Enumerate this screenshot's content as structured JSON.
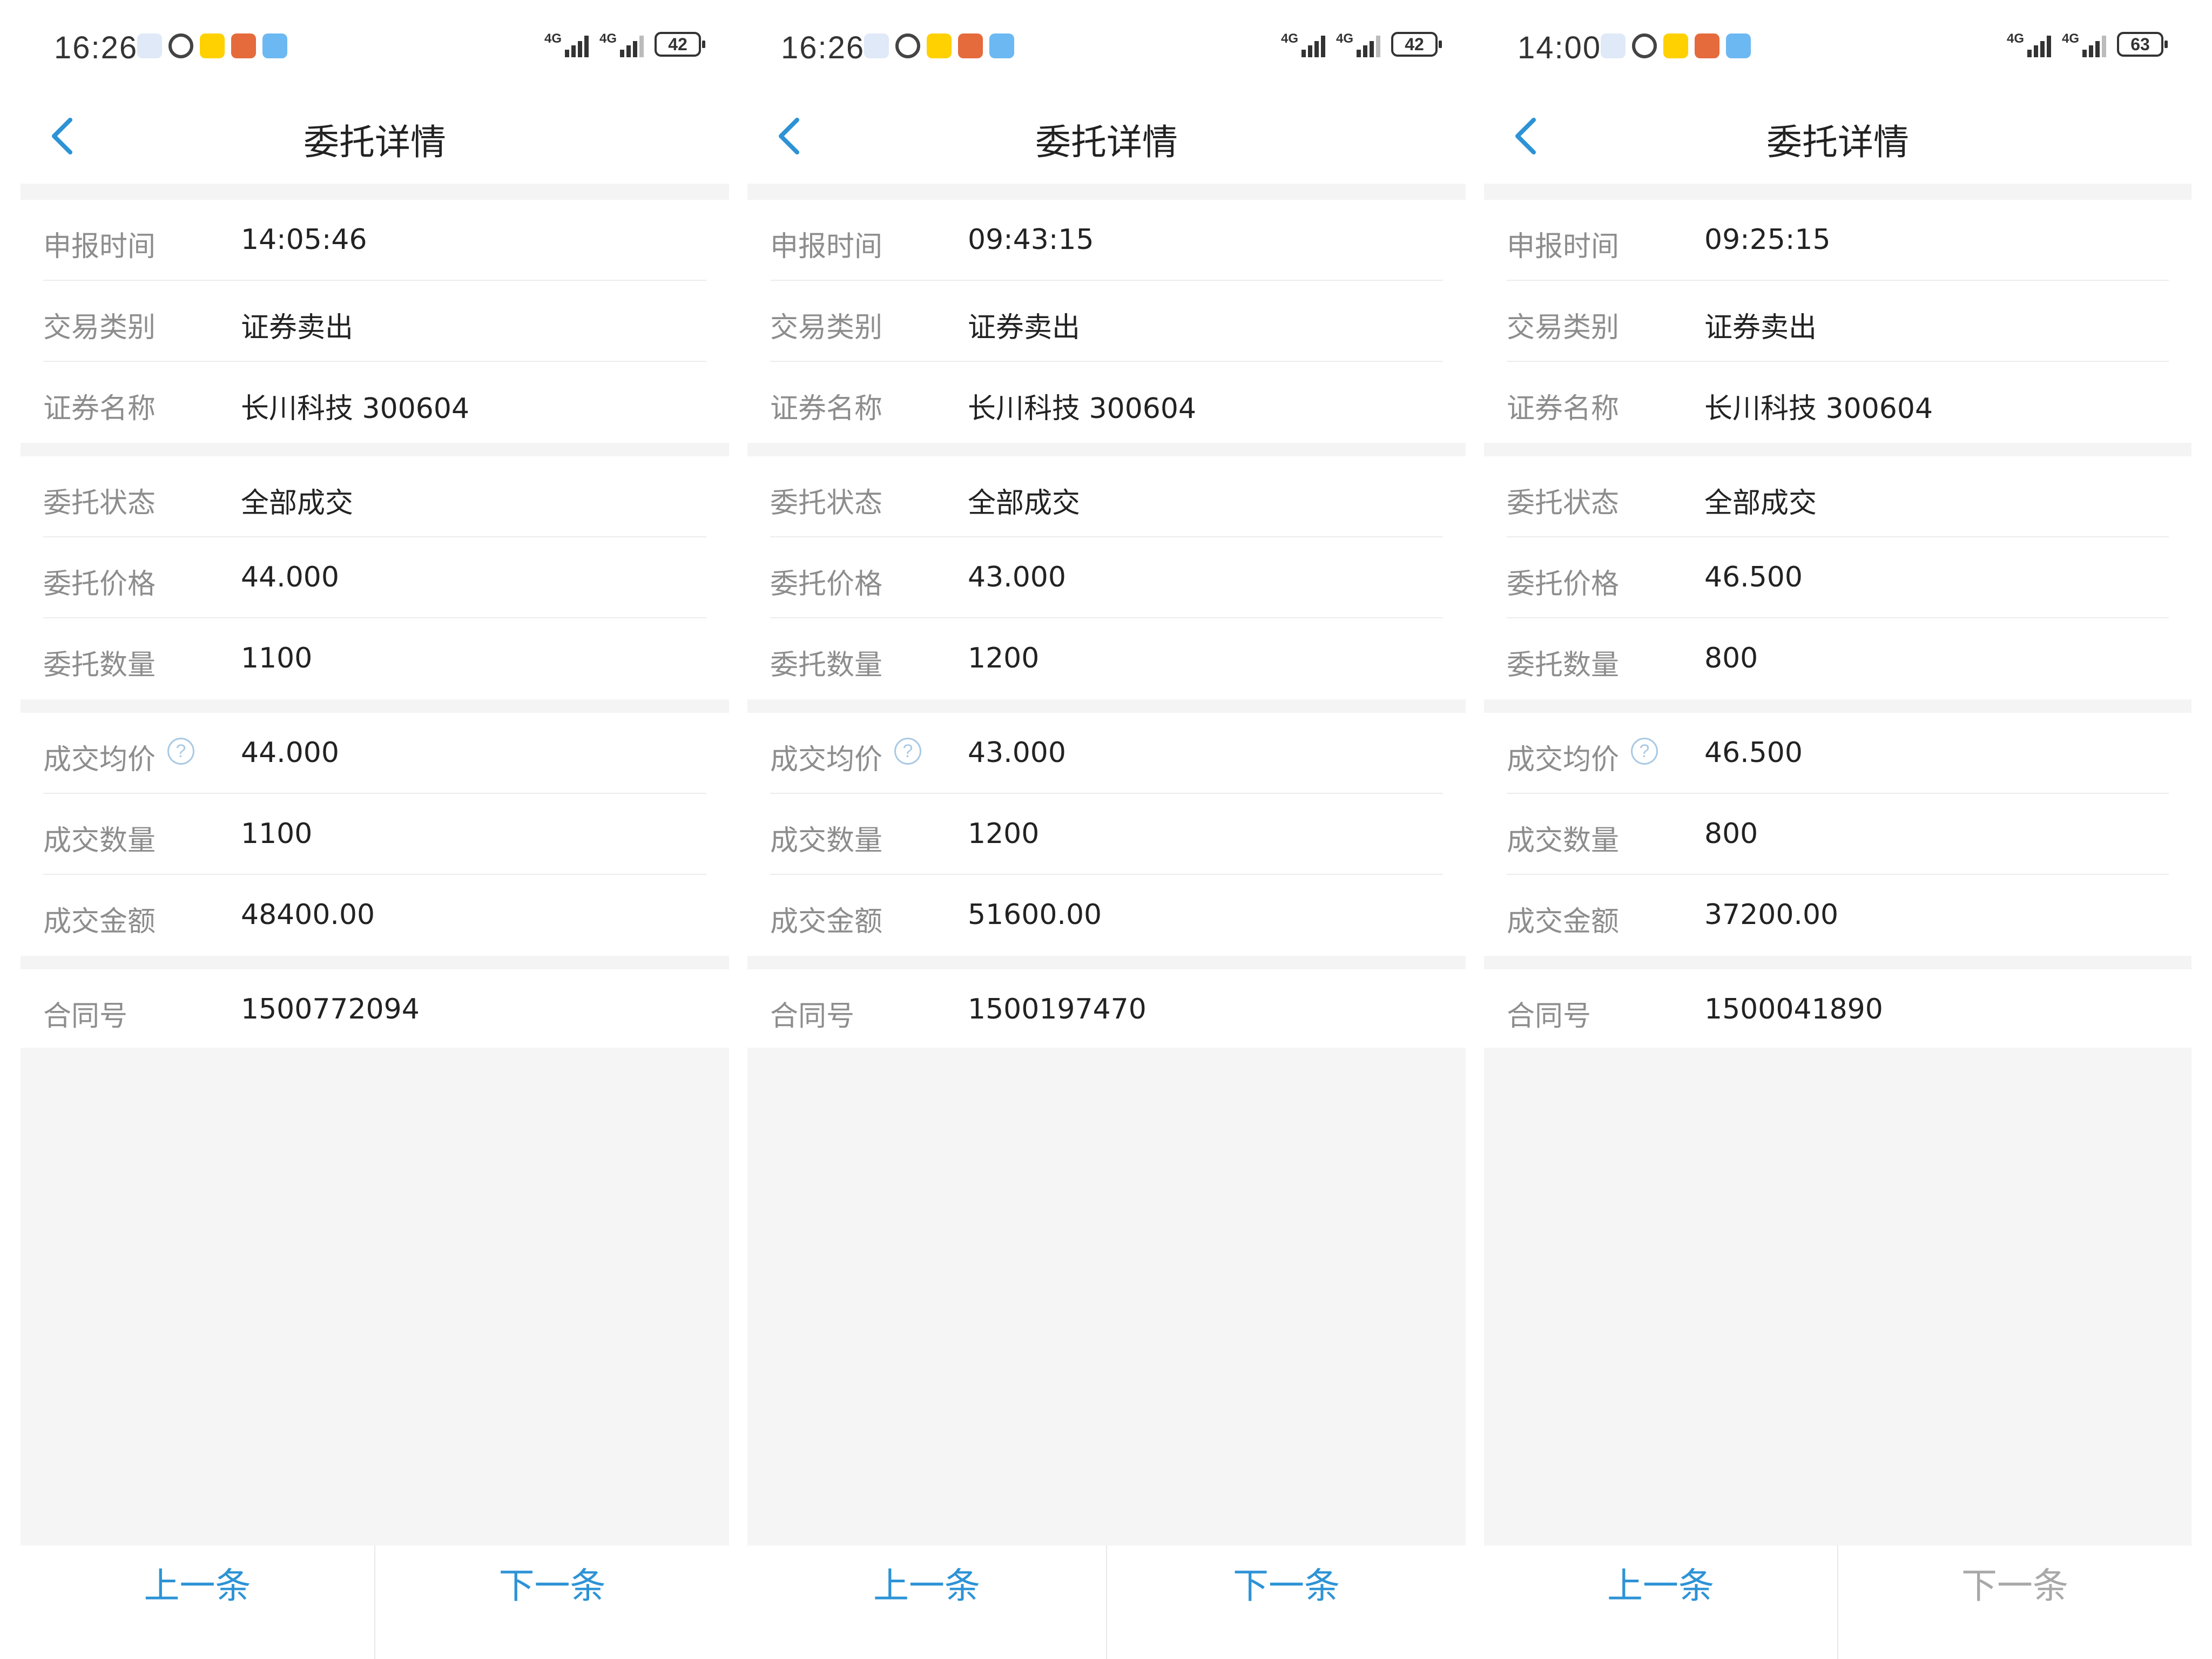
{
  "accent_color": "#2d93d6",
  "label_color": "#8d8d8d",
  "screens": [
    {
      "status_bar": {
        "time": "16:26",
        "network": "4G",
        "battery": "42",
        "notification_icons": [
          "cloud-app-icon",
          "record-icon",
          "meituan-icon",
          "game-icon",
          "weather-icon"
        ]
      },
      "title": "委托详情",
      "fields": {
        "declare_time": {
          "label": "申报时间",
          "value": "14:05:46"
        },
        "trade_type": {
          "label": "交易类别",
          "value": "证券卖出"
        },
        "security_name": {
          "label": "证券名称",
          "value": "长川科技 300604"
        },
        "order_status": {
          "label": "委托状态",
          "value": "全部成交"
        },
        "order_price": {
          "label": "委托价格",
          "value": "44.000"
        },
        "order_qty": {
          "label": "委托数量",
          "value": "1100"
        },
        "avg_price": {
          "label": "成交均价",
          "value": "44.000"
        },
        "filled_qty": {
          "label": "成交数量",
          "value": "1100"
        },
        "filled_amount": {
          "label": "成交金额",
          "value": "48400.00"
        },
        "contract_no": {
          "label": "合同号",
          "value": "1500772094"
        }
      },
      "help_glyph": "?",
      "prev_label": "上一条",
      "next_label": "下一条"
    },
    {
      "status_bar": {
        "time": "16:26",
        "network": "4G",
        "battery": "42",
        "notification_icons": [
          "cloud-app-icon",
          "record-icon",
          "meituan-icon",
          "game-icon",
          "weather-icon"
        ]
      },
      "title": "委托详情",
      "fields": {
        "declare_time": {
          "label": "申报时间",
          "value": "09:43:15"
        },
        "trade_type": {
          "label": "交易类别",
          "value": "证券卖出"
        },
        "security_name": {
          "label": "证券名称",
          "value": "长川科技 300604"
        },
        "order_status": {
          "label": "委托状态",
          "value": "全部成交"
        },
        "order_price": {
          "label": "委托价格",
          "value": "43.000"
        },
        "order_qty": {
          "label": "委托数量",
          "value": "1200"
        },
        "avg_price": {
          "label": "成交均价",
          "value": "43.000"
        },
        "filled_qty": {
          "label": "成交数量",
          "value": "1200"
        },
        "filled_amount": {
          "label": "成交金额",
          "value": "51600.00"
        },
        "contract_no": {
          "label": "合同号",
          "value": "1500197470"
        }
      },
      "help_glyph": "?",
      "prev_label": "上一条",
      "next_label": "下一条"
    },
    {
      "status_bar": {
        "time": "14:00",
        "network": "4G",
        "battery": "63",
        "notification_icons": [
          "red-app-icon",
          "record-icon",
          "orange-app-icon",
          "blue-app-icon",
          "red-app-icon"
        ]
      },
      "title": "委托详情",
      "fields": {
        "declare_time": {
          "label": "申报时间",
          "value": "09:25:15"
        },
        "trade_type": {
          "label": "交易类别",
          "value": "证券卖出"
        },
        "security_name": {
          "label": "证券名称",
          "value": "长川科技 300604"
        },
        "order_status": {
          "label": "委托状态",
          "value": "全部成交"
        },
        "order_price": {
          "label": "委托价格",
          "value": "46.500"
        },
        "order_qty": {
          "label": "委托数量",
          "value": "800"
        },
        "avg_price": {
          "label": "成交均价",
          "value": "46.500"
        },
        "filled_qty": {
          "label": "成交数量",
          "value": "800"
        },
        "filled_amount": {
          "label": "成交金额",
          "value": "37200.00"
        },
        "contract_no": {
          "label": "合同号",
          "value": "1500041890"
        }
      },
      "help_glyph": "?",
      "prev_label": "上一条",
      "next_label": "下一条",
      "next_disabled": true
    }
  ]
}
